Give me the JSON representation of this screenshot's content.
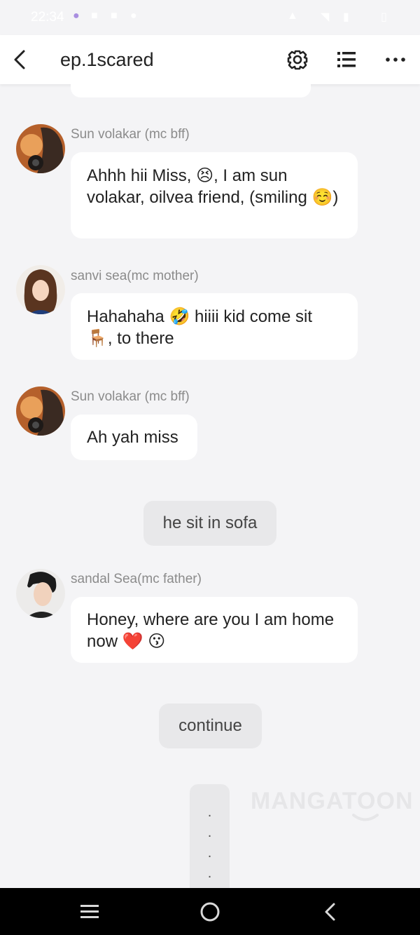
{
  "status_bar": {
    "time": "22:34"
  },
  "header": {
    "title": "ep.1scared"
  },
  "messages": [
    {
      "speaker": "Sun volakar (mc bff)",
      "text_a": "Ahhh hii Miss, ",
      "emoji_a": "😣",
      "text_b": ", I am sun volakar, oilvea friend, (smiling ",
      "emoji_b": "☺️",
      "text_c": ")"
    },
    {
      "speaker": "sanvi sea(mc mother)",
      "text_a": "Hahahaha ",
      "emoji_a": "🤣",
      "text_b": " hiiii kid come sit ",
      "emoji_b": "🪑",
      "text_c": ", to there"
    },
    {
      "speaker": "Sun volakar (mc bff)",
      "text_a": "Ah yah miss"
    },
    {
      "narration": "he sit in sofa"
    },
    {
      "speaker": "sandal Sea(mc father)",
      "text_a": "Honey, where are you I am home now ",
      "emoji_a": "❤️",
      "text_b": " ",
      "emoji_b": "😗"
    }
  ],
  "continue_label": "continue",
  "dots": [
    ".",
    ".",
    ".",
    "."
  ],
  "watermark": "MANGATOON",
  "colors": {
    "background": "#f4f4f6",
    "bubble": "#ffffff",
    "narration": "#e8e8ea",
    "speaker": "#8b8b8b"
  }
}
